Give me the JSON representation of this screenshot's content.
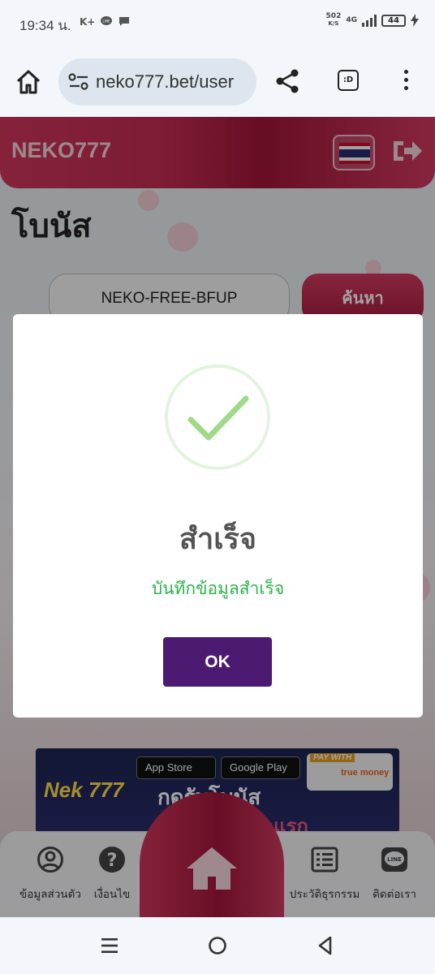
{
  "status_bar": {
    "time": "19:34 น.",
    "left_icons": [
      "K+",
      "line-icon",
      "chat-icon"
    ],
    "net_speed_value": "502",
    "net_speed_unit": "K/S",
    "network": "4G",
    "battery": "44"
  },
  "browser": {
    "url": "neko777.bet/user",
    "tab_label": ":D"
  },
  "site": {
    "brand": "NEKO777",
    "page_title": "โบนัส",
    "code_value": "NEKO-FREE-BFUP",
    "search_label": "ค้นหา",
    "banner": {
      "app_store": "App Store",
      "google_play": "Google Play",
      "pay_with": "PAY WITH",
      "truemoney": "true money",
      "line1": "กดรับโบนัส",
      "line2": "โปรฝากบิลแรก",
      "logo": "Nek 777"
    },
    "nav": {
      "profile": "ข้อมูลส่วนตัว",
      "conditions": "เงื่อนไข",
      "history": "ประวัติธุรกรรม",
      "contact": "ติดต่อเรา"
    }
  },
  "modal": {
    "title": "สำเร็จ",
    "message": "บันทึกข้อมูลสำเร็จ",
    "ok_label": "OK",
    "accent_color": "#2bb34a",
    "button_color": "#4d1a72"
  },
  "colors": {
    "brand_gradient_start": "#d1365c",
    "brand_gradient_mid": "#a0163a"
  }
}
